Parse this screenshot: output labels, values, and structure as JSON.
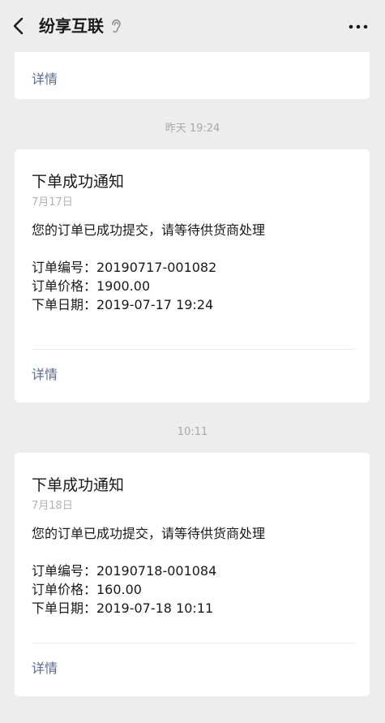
{
  "header": {
    "title": "纷享互联",
    "back_icon": "chevron-left-icon",
    "ear_icon": "ear-icon",
    "more_icon": "more-dots-icon"
  },
  "messages": [
    {
      "detail_label": "详情"
    },
    {
      "time": "昨天 19:24",
      "title": "下单成功通知",
      "date": "7月17日",
      "description": "您的订单已成功提交，请等待供货商处理",
      "fields": [
        "订单编号：20190717-001082",
        "订单价格：1900.00",
        "下单日期：2019-07-17 19:24"
      ],
      "detail_label": "详情"
    },
    {
      "time": "10:11",
      "title": "下单成功通知",
      "date": "7月18日",
      "description": "您的订单已成功提交，请等待供货商处理",
      "fields": [
        "订单编号：20190718-001084",
        "订单价格：160.00",
        "下单日期：2019-07-18 10:11"
      ],
      "detail_label": "详情"
    }
  ],
  "colors": {
    "background": "#ededed",
    "card": "#ffffff",
    "link": "#576b95",
    "timestamp": "#a8a8a8"
  }
}
